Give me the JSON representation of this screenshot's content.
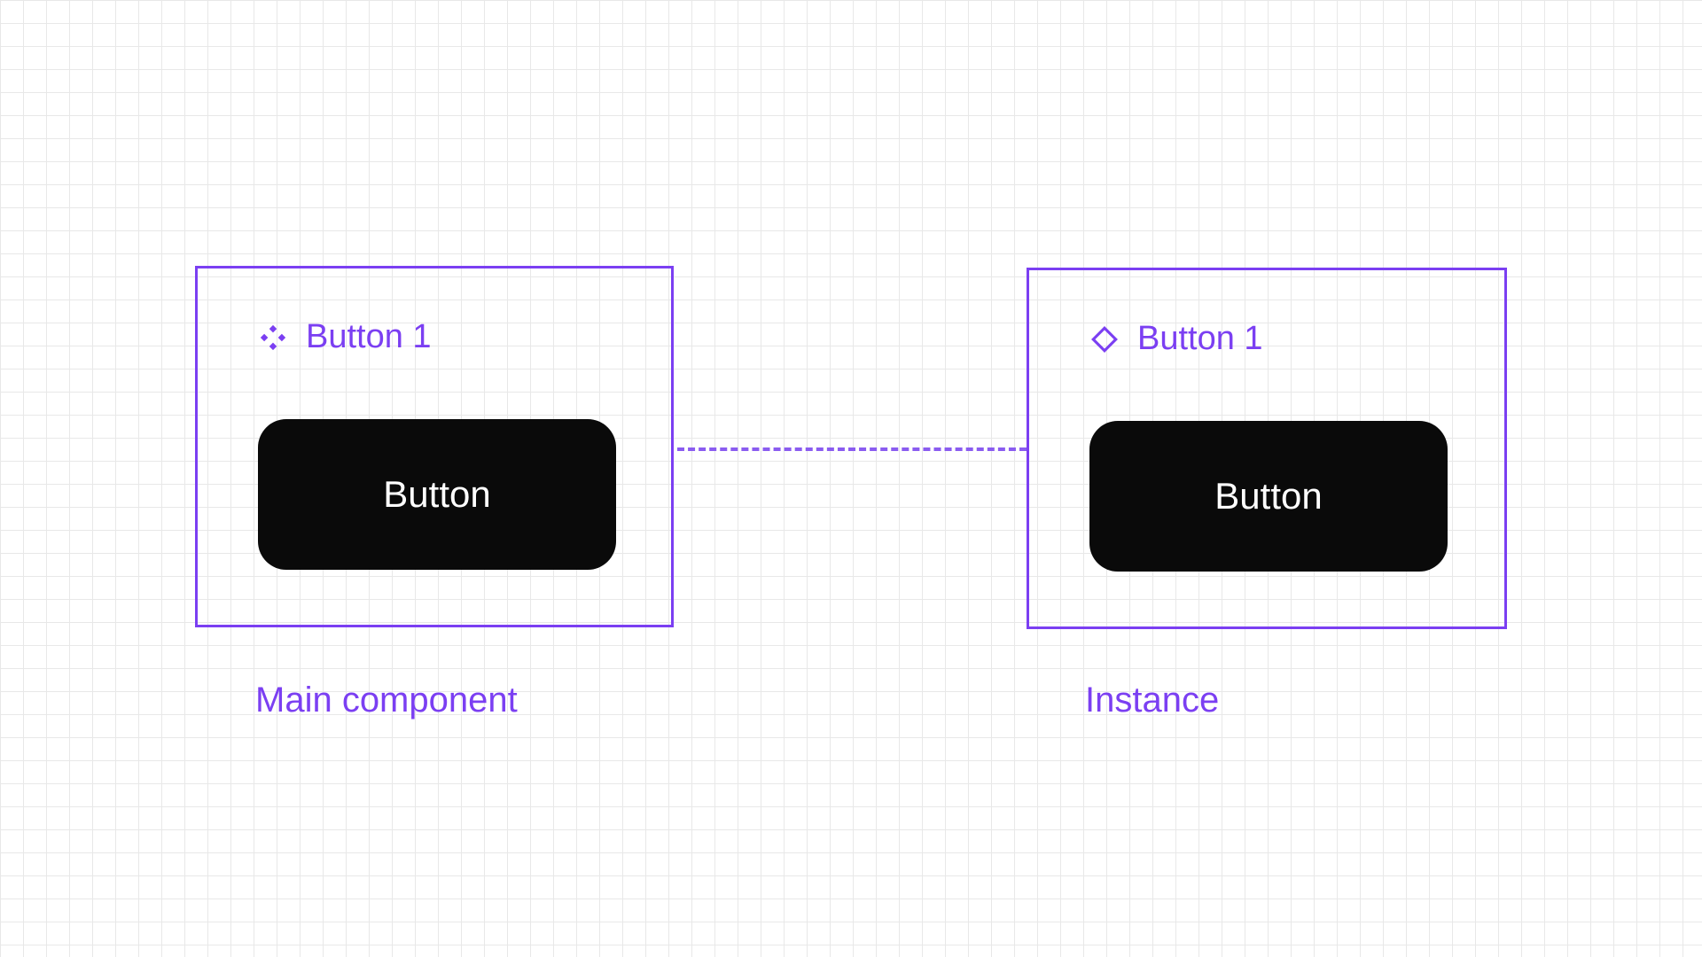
{
  "colors": {
    "accent": "#7b3ff2",
    "button_bg": "#0a0a0a",
    "button_text": "#ffffff",
    "grid_minor": "#e8e8e8",
    "grid_major": "#d8d8d8"
  },
  "main_component": {
    "title": "Button 1",
    "button_label": "Button",
    "caption": "Main component",
    "icon": "component-filled-icon"
  },
  "instance": {
    "title": "Button 1",
    "button_label": "Button",
    "caption": "Instance",
    "icon": "component-outline-icon"
  }
}
